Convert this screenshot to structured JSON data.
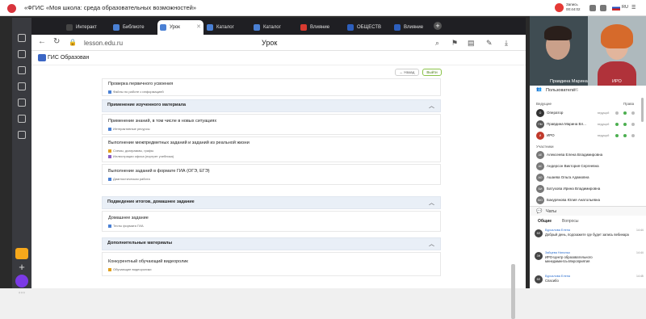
{
  "topbar": {
    "title": "«ФГИС «Моя школа: среда образовательных возможностей»",
    "rec_line1": "Запись",
    "rec_line2": "00:44:02",
    "lang": "RU"
  },
  "tabs": [
    {
      "label": "Интеракт",
      "color": "#2b2b2b"
    },
    {
      "label": "Библиоте",
      "color": "#4a80d4"
    },
    {
      "label": "Урок",
      "color": "#4a80d4",
      "active": true
    },
    {
      "label": "Каталог",
      "color": "#4a80d4"
    },
    {
      "label": "Каталог",
      "color": "#4a80d4"
    },
    {
      "label": "Влияние",
      "color": "#d93a30"
    },
    {
      "label": "ОБЩЕСТВ",
      "color": "#2d5fbd"
    },
    {
      "label": "Влияние",
      "color": "#2d5fbd"
    }
  ],
  "address": {
    "url": "lesson.edu.ru",
    "page_title": "Урок",
    "new_tab": "+"
  },
  "bookmark": {
    "label": "ГИС Образован"
  },
  "lesson": {
    "btn_back": "← Назад",
    "btn_next": "Выйти",
    "item_top": {
      "title": "Проверка первичного усвоения",
      "sub": "Файлы по работе с информацией"
    },
    "sections": [
      {
        "title": "Применение изученного материала",
        "items": [
          {
            "title": "Применение знаний, в том числе в новых ситуациях",
            "subs": [
              "Интерактивные ресурсы"
            ]
          },
          {
            "title": "Выполнение межпредметных заданий и заданий из реальной жизни",
            "subs": [
              "Схемы, диаграммы, графы",
              "Иллюстрации офиса (портрет учебника)"
            ]
          },
          {
            "title": "Выполнение заданий в формате ГИА (ОГЭ, ЕГЭ)",
            "subs": [
              "Диагностическая работа"
            ]
          }
        ]
      },
      {
        "title": "Подведение итогов, домашнее задание",
        "items": [
          {
            "title": "Домашнее задание",
            "subs": [
              "Тесты формата ГИА"
            ]
          }
        ]
      },
      {
        "title": "Дополнительные материалы",
        "items": [
          {
            "title": "Конкурентный обучающий видеоролик",
            "subs": [
              "Обучающие видеоролики"
            ]
          }
        ]
      }
    ]
  },
  "right_panel": {
    "cam1_name": "Правдина Марина",
    "cam2_name": "ИРО",
    "users_title": "Пользователи",
    "users_count": "96",
    "hosts_label": "Ведущие",
    "rights_label": "Права",
    "participants_label": "Участники",
    "hosts": [
      {
        "initials": "О",
        "name": "Оператор",
        "role": "ведущий",
        "color": "#333333"
      },
      {
        "initials": "ПМ",
        "name": "Правдина Марина Вл...",
        "role": "ведущий",
        "color": "#555555"
      },
      {
        "initials": "И",
        "name": "ИРО",
        "role": "ведущий",
        "color": "#c0392b"
      }
    ],
    "participants": [
      {
        "initials": "АЕ",
        "name": "Алексеева Елена Владимировна",
        "color": "#777777"
      },
      {
        "initials": "АС",
        "name": "Андерсон Виктория Сергеевна",
        "color": "#777777"
      },
      {
        "initials": "АО",
        "name": "Ашаева Ольга Адамовна",
        "color": "#777777"
      },
      {
        "initials": "БИ",
        "name": "Батухова Ирина Владимировна",
        "color": "#777777"
      },
      {
        "initials": "БЮ",
        "name": "Бакурянова Юлия Анатольевна",
        "color": "#777777"
      }
    ],
    "chats_title": "Чаты",
    "chat_tabs": [
      "Общие",
      "Вопросы"
    ],
    "messages": [
      {
        "initials": "БЕ",
        "name": "Бурсалова Елена",
        "time": "14:44",
        "text": "Добрый день, подскажите где будет запись вебинара"
      },
      {
        "initials": "ЗН",
        "name": "Зайцева Наталья",
        "time": "14:44",
        "text": "ИРО-Центр образовательного менеджмента=Мероприятия"
      },
      {
        "initials": "БЕ",
        "name": "Бурсалова Елена",
        "time": "14:45",
        "text": "Спасибо"
      }
    ]
  }
}
